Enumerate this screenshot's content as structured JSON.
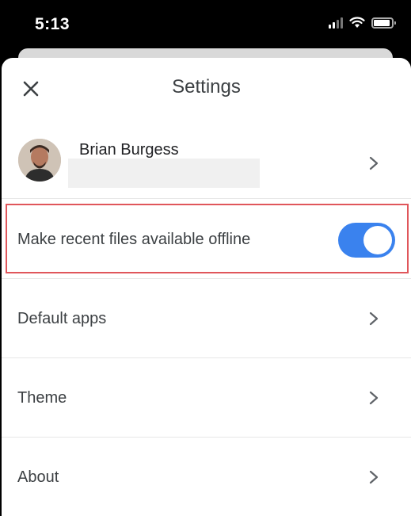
{
  "status_bar": {
    "time": "5:13"
  },
  "header": {
    "title": "Settings"
  },
  "account": {
    "name": "Brian Burgess"
  },
  "offline": {
    "label": "Make recent files available offline",
    "enabled": true
  },
  "items": [
    {
      "label": "Default apps"
    },
    {
      "label": "Theme"
    },
    {
      "label": "About"
    }
  ],
  "colors": {
    "toggle_on": "#3a82ee",
    "highlight_border": "#e0565b"
  }
}
